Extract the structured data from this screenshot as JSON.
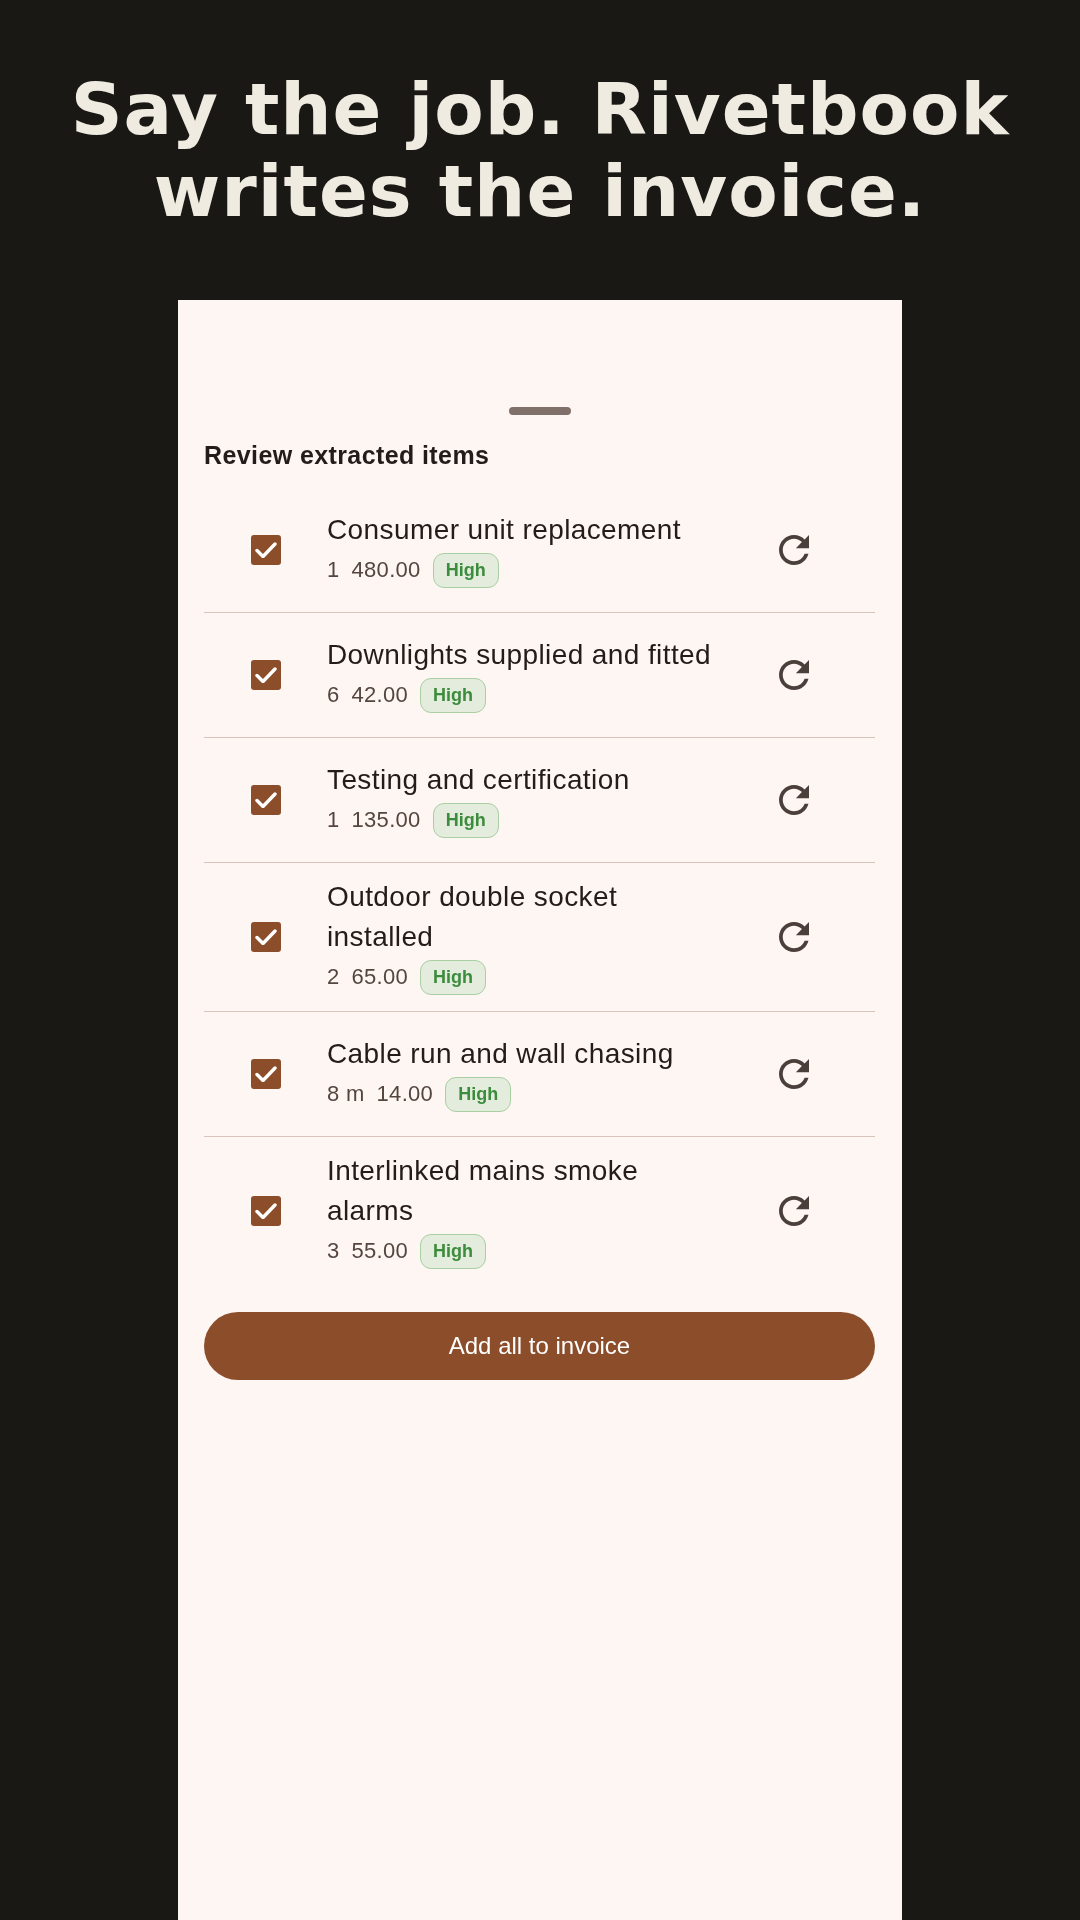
{
  "headline": "Say the job. Rivetbook writes the invoice.",
  "sheet": {
    "title": "Review extracted items",
    "items": [
      {
        "description": "Consumer unit replacement",
        "quantity": "1",
        "price": "480.00",
        "confidence": "High",
        "checked": true
      },
      {
        "description": "Downlights supplied and fitted",
        "quantity": "6",
        "price": "42.00",
        "confidence": "High",
        "checked": true
      },
      {
        "description": "Testing and certification",
        "quantity": "1",
        "price": "135.00",
        "confidence": "High",
        "checked": true
      },
      {
        "description": "Outdoor double socket installed",
        "quantity": "2",
        "price": "65.00",
        "confidence": "High",
        "checked": true
      },
      {
        "description": "Cable run and wall chasing",
        "quantity": "8 m",
        "price": "14.00",
        "confidence": "High",
        "checked": true
      },
      {
        "description": "Interlinked mains smoke alarms",
        "quantity": "3",
        "price": "55.00",
        "confidence": "High",
        "checked": true
      }
    ],
    "button": "Add all to invoice"
  }
}
